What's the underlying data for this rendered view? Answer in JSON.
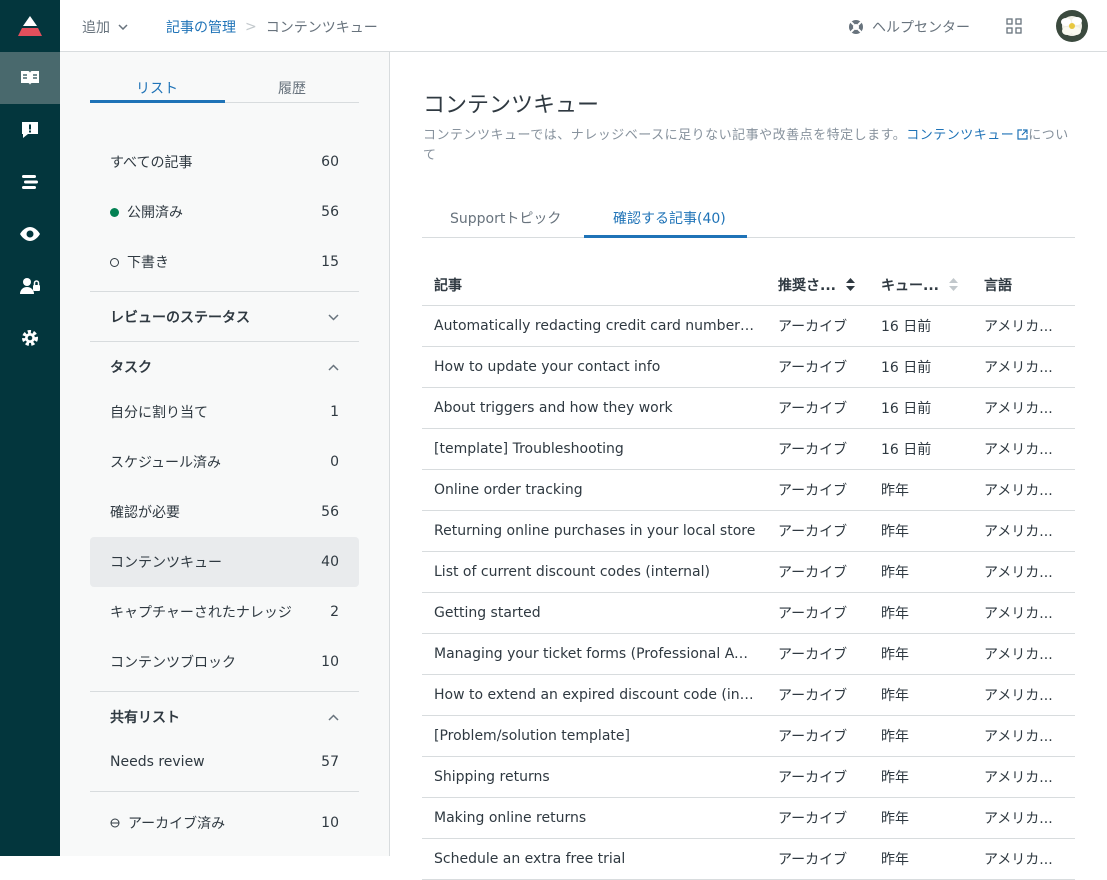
{
  "colors": {
    "rail": "#03363d",
    "accent": "#1f73b7",
    "published": "#038153",
    "logo": "#e34f5c"
  },
  "rail_icons": [
    "guide-logo-icon",
    "knowledge-book-icon",
    "alert-bubble-icon",
    "list-icon",
    "eye-icon",
    "user-lock-icon",
    "gear-icon"
  ],
  "topbar": {
    "add_label": "追加",
    "breadcrumb_parent": "記事の管理",
    "breadcrumb_sep": ">",
    "breadcrumb_current": "コンテンツキュー",
    "help_label": "ヘルプセンター"
  },
  "sidebar": {
    "tabs": [
      "リスト",
      "履歴"
    ],
    "all_articles": {
      "label": "すべての記事",
      "count": "60"
    },
    "published": {
      "label": "公開済み",
      "count": "56"
    },
    "draft": {
      "label": "下書き",
      "count": "15"
    },
    "review_status": "レビューのステータス",
    "tasks_header": "タスク",
    "tasks": [
      {
        "label": "自分に割り当て",
        "count": "1"
      },
      {
        "label": "スケジュール済み",
        "count": "0"
      },
      {
        "label": "確認が必要",
        "count": "56"
      },
      {
        "label": "コンテンツキュー",
        "count": "40"
      },
      {
        "label": "キャプチャーされたナレッジ",
        "count": "2"
      },
      {
        "label": "コンテンツブロック",
        "count": "10"
      }
    ],
    "shared_header": "共有リスト",
    "shared": [
      {
        "label": "Needs review",
        "count": "57"
      }
    ],
    "archived": {
      "label": "アーカイブ済み",
      "count": "10"
    }
  },
  "main": {
    "title": "コンテンツキュー",
    "desc_text": "コンテンツキューでは、ナレッジベースに足りない記事や改善点を特定します。",
    "desc_link": "コンテンツキュー",
    "desc_tail": "について",
    "tabs": [
      "Supportトピック",
      "確認する記事(40)"
    ],
    "columns": [
      "記事",
      "推奨さ...",
      "キュー...",
      "言語"
    ],
    "rows": [
      [
        "Automatically redacting credit card numbers from tickets",
        "アーカイブ",
        "16 日前",
        "アメリカ..."
      ],
      [
        "How to update your contact info",
        "アーカイブ",
        "16 日前",
        "アメリカ..."
      ],
      [
        "About triggers and how they work",
        "アーカイブ",
        "16 日前",
        "アメリカ..."
      ],
      [
        "[template] Troubleshooting",
        "アーカイブ",
        "16 日前",
        "アメリカ..."
      ],
      [
        "Online order tracking",
        "アーカイブ",
        "昨年",
        "アメリカ..."
      ],
      [
        "Returning online purchases in your local store",
        "アーカイブ",
        "昨年",
        "アメリカ..."
      ],
      [
        "List of current discount codes (internal)",
        "アーカイブ",
        "昨年",
        "アメリカ..."
      ],
      [
        "Getting started",
        "アーカイブ",
        "昨年",
        "アメリカ..."
      ],
      [
        "Managing your ticket forms (Professional Add-on and Enterprise)",
        "アーカイブ",
        "昨年",
        "アメリカ..."
      ],
      [
        "How to extend an expired discount code (internal)",
        "アーカイブ",
        "昨年",
        "アメリカ..."
      ],
      [
        "[Problem/solution template]",
        "アーカイブ",
        "昨年",
        "アメリカ..."
      ],
      [
        "Shipping returns",
        "アーカイブ",
        "昨年",
        "アメリカ..."
      ],
      [
        "Making online returns",
        "アーカイブ",
        "昨年",
        "アメリカ..."
      ],
      [
        "Schedule an extra free trial",
        "アーカイブ",
        "昨年",
        "アメリカ..."
      ]
    ]
  }
}
